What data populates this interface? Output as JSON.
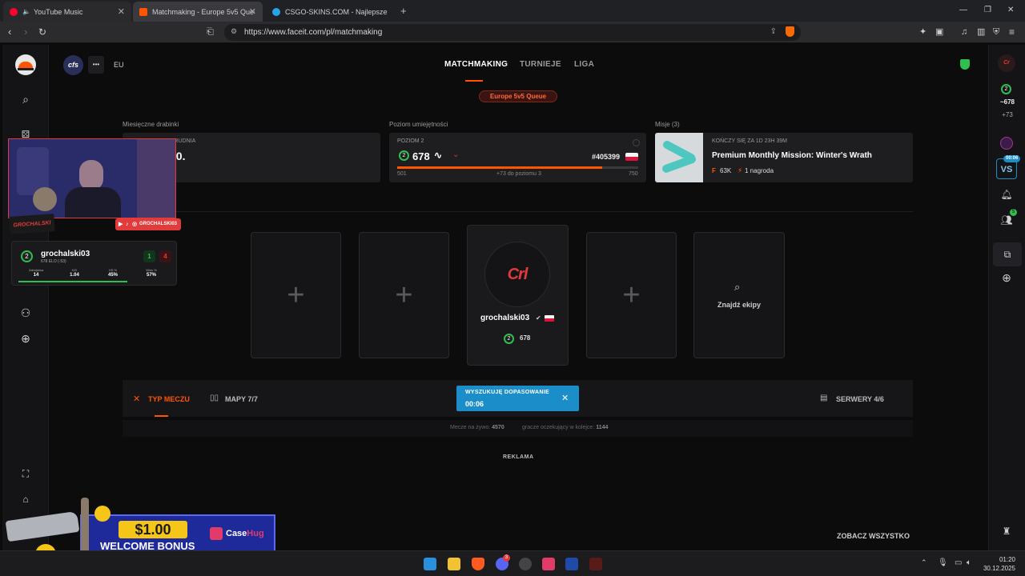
{
  "browser": {
    "tabs": [
      {
        "label": "YouTube Music",
        "color": "#ff0033"
      },
      {
        "label": "Matchmaking - Europe 5v5 Queue",
        "color": "#ff5500"
      },
      {
        "label": "CSGO-SKINS.COM - Najlepsze Skrzyn",
        "color": "#29a3e8"
      }
    ],
    "url": "https://www.faceit.com/pl/matchmaking"
  },
  "header": {
    "org_badge": "cfs",
    "more": "•••",
    "region": "EU",
    "nav": [
      "MATCHMAKING",
      "TURNIEJE",
      "LIGA"
    ],
    "queue_pill": "Europe 5v5 Queue"
  },
  "ladders": {
    "section_label": "Miesięczne drabinki",
    "card_label": "GRUDNIA",
    "value": "50."
  },
  "skill": {
    "section_label": "Poziom umiejętności",
    "level_label": "POZIOM 2",
    "level": "2",
    "elo": "678",
    "rank": "#405399",
    "progress": 0.85,
    "min": "501",
    "to_next": "+73 do poziomu 3",
    "max": "750"
  },
  "missions": {
    "section_label": "Misje (3)",
    "timer": "KOŃCZY SIĘ ZA 1D 23H 39M",
    "title": "Premium Monthly Mission: Winter's Wrath",
    "points": "63K",
    "reward": "1 nagroda"
  },
  "overlay": {
    "streamer_logo": "GROCHALSKI",
    "social_handle": "GROCHALSKI03",
    "player_name": "grochalski03",
    "player_elo": "678 ELO (-53)",
    "level": "2",
    "wins": "1",
    "losses": "4",
    "stats": [
      {
        "label": "Zabójstwa",
        "value": "14"
      },
      {
        "label": "K/D",
        "value": "1.04"
      },
      {
        "label": "HS %",
        "value": "45%"
      },
      {
        "label": "Wins %",
        "value": "57%"
      }
    ]
  },
  "party": {
    "player_name": "grochalski03",
    "level": "2",
    "elo": "678",
    "find_team": "Znajdź ekipy"
  },
  "queue_bar": {
    "match_type": "TYP MECZU",
    "maps": "MAPY 7/7",
    "searching": "WYSZUKUJĘ DOPASOWANIE",
    "timer": "00:06",
    "servers": "SERWERY 4/6",
    "live_matches_label": "Mecze na żywo:",
    "live_matches": "4570",
    "waiting_label": "gracze oczekujący w kolejce:",
    "waiting": "1144"
  },
  "ad_label": "REKLAMA",
  "see_all": "ZOBACZ WSZYSTKO",
  "right_sidebar": {
    "level": "2",
    "elo": "~678",
    "delta": "+73",
    "vs_timer": "00:06",
    "vs": "VS",
    "friends_badge": "5"
  },
  "banner": {
    "amount": "$1.00",
    "text": "WELCOME BONUS",
    "brand_a": "Case",
    "brand_b": "Hug"
  },
  "taskbar": {
    "time": "01:20",
    "date": "30.12.2025",
    "discord_badge": "3"
  },
  "colors": {
    "accent": "#ff5500",
    "level_green": "#2fbf4f",
    "search_blue": "#1b8ec9"
  }
}
